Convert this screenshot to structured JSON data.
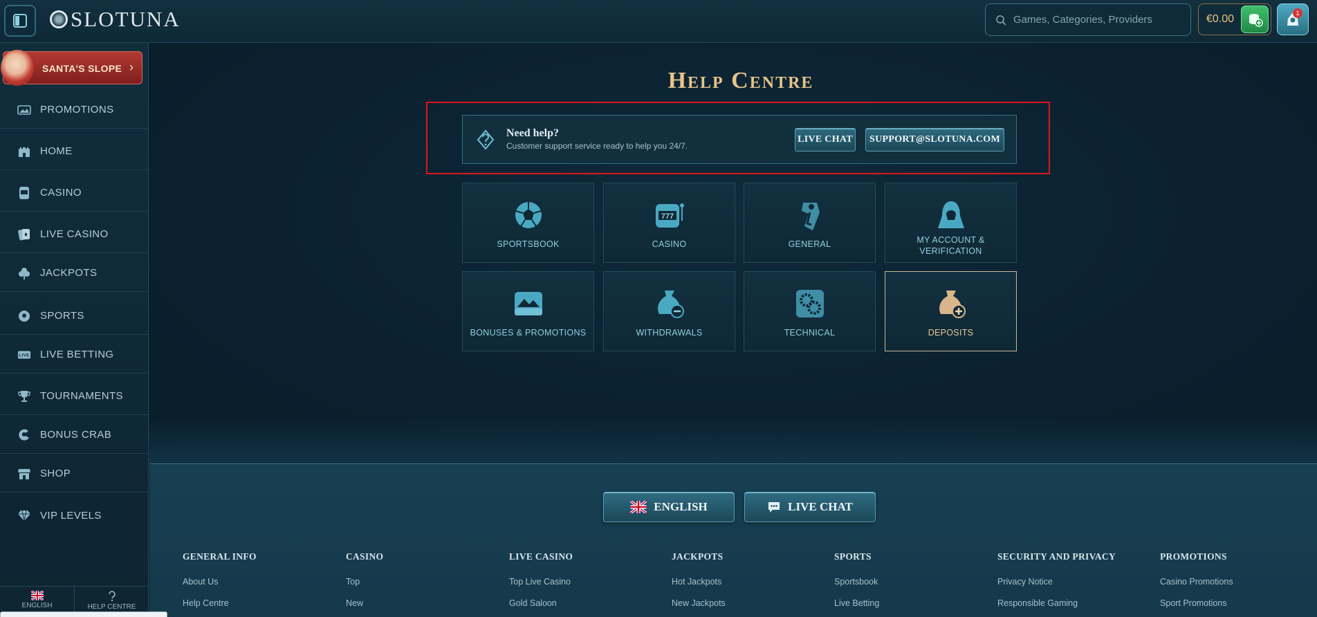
{
  "header": {
    "logo_text": "SLOTUNA",
    "search_placeholder": "Games, Categories, Providers",
    "balance": "€0.00",
    "notification_count": "1"
  },
  "sidebar": {
    "promo_banner": "SANTA'S SLOPE",
    "items": [
      {
        "label": "PROMOTIONS",
        "icon": "promotions-icon"
      },
      {
        "label": "HOME",
        "icon": "castle-icon"
      },
      {
        "label": "CASINO",
        "icon": "slot-machine-icon"
      },
      {
        "label": "LIVE CASINO",
        "icon": "cards-icon"
      },
      {
        "label": "JACKPOTS",
        "icon": "clover-icon"
      },
      {
        "label": "SPORTS",
        "icon": "soccer-ball-icon"
      },
      {
        "label": "LIVE BETTING",
        "icon": "live-icon"
      },
      {
        "label": "TOURNAMENTS",
        "icon": "trophy-icon"
      },
      {
        "label": "BONUS CRAB",
        "icon": "crab-claw-icon"
      },
      {
        "label": "SHOP",
        "icon": "shop-icon"
      },
      {
        "label": "VIP LEVELS",
        "icon": "diamond-icon"
      }
    ],
    "bottom": {
      "language": "ENGLISH",
      "help": "HELP CENTRE"
    }
  },
  "help": {
    "title": "Help Centre",
    "need_help_title": "Need help?",
    "need_help_sub": "Customer support service ready to help you 24/7.",
    "live_chat_label": "LIVE CHAT",
    "email_label": "SUPPORT@SLOTUNA.COM"
  },
  "categories": [
    {
      "label": "SPORTSBOOK",
      "icon": "soccer-ball-icon"
    },
    {
      "label": "CASINO",
      "icon": "slot-machine-icon"
    },
    {
      "label": "GENERAL",
      "icon": "info-icon"
    },
    {
      "label": "MY ACCOUNT & VERIFICATION",
      "icon": "hooded-figure-icon"
    },
    {
      "label": "BONUSES & PROMOTIONS",
      "icon": "treasure-chest-icon"
    },
    {
      "label": "WITHDRAWALS",
      "icon": "money-bag-minus-icon"
    },
    {
      "label": "TECHNICAL",
      "icon": "gears-icon"
    },
    {
      "label": "DEPOSITS",
      "icon": "money-bag-plus-icon",
      "active": true
    }
  ],
  "footer": {
    "language_button": "ENGLISH",
    "live_chat_button": "LIVE CHAT",
    "columns": [
      {
        "title": "GENERAL INFO",
        "links": [
          "About Us",
          "Help Centre"
        ]
      },
      {
        "title": "CASINO",
        "links": [
          "Top",
          "New"
        ]
      },
      {
        "title": "LIVE CASINO",
        "links": [
          "Top Live Casino",
          "Gold Saloon"
        ]
      },
      {
        "title": "JACKPOTS",
        "links": [
          "Hot Jackpots",
          "New Jackpots"
        ]
      },
      {
        "title": "SPORTS",
        "links": [
          "Sportsbook",
          "Live Betting"
        ]
      },
      {
        "title": "SECURITY AND PRIVACY",
        "links": [
          "Privacy Notice",
          "Responsible Gaming"
        ]
      },
      {
        "title": "PROMOTIONS",
        "links": [
          "Casino Promotions",
          "Sport Promotions"
        ]
      }
    ]
  },
  "colors": {
    "accent_gold": "#e6c489",
    "teal": "#8fd0e0",
    "highlight_red": "#e0151f"
  }
}
